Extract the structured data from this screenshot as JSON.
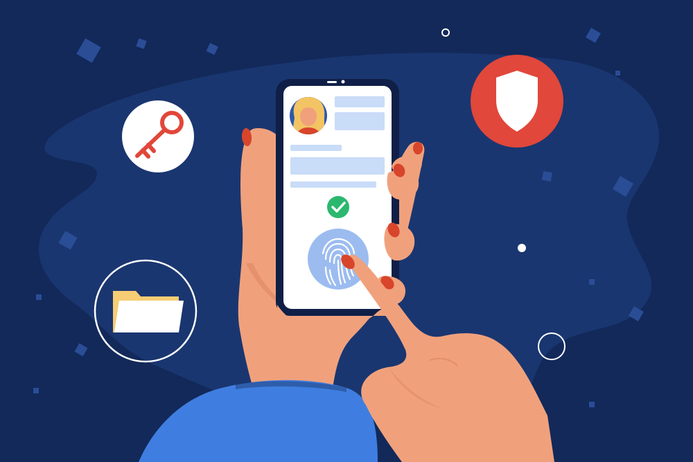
{
  "colors": {
    "background": "#12295a",
    "blob": "#1a3670",
    "confetti": "#2a4d96",
    "phone_body": "#0f1f47",
    "screen": "#ffffff",
    "placeholder": "#c9dcf8",
    "avatar_bg": "#2d58a8",
    "hair": "#f2c463",
    "skin": "#f0a17c",
    "skin_shadow": "#d9825f",
    "nail": "#d8452b",
    "check": "#2bb86e",
    "fingerprint_bg": "#9cbcf0",
    "fingerprint_lines": "#ffffff",
    "shield_circle": "#e1473a",
    "shield": "#ffffff",
    "key_circle": "#ffffff",
    "key": "#e1473a",
    "folder_back": "#f6cd75",
    "folder_front": "#ffffff",
    "sleeve": "#3f7ee0"
  },
  "icons": [
    "key-icon",
    "shield-icon",
    "folder-icon",
    "fingerprint-icon",
    "check-icon",
    "user-avatar-icon"
  ]
}
